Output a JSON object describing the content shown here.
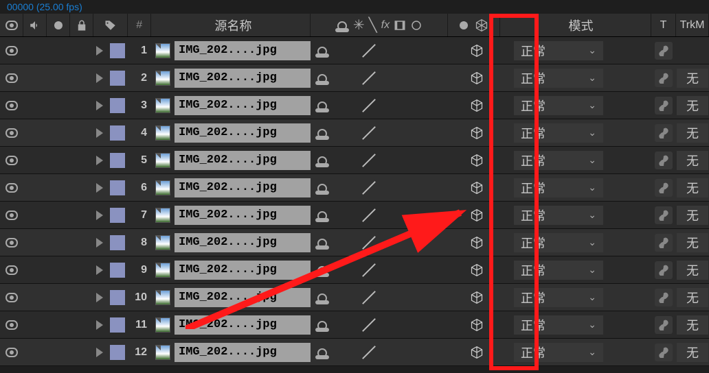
{
  "info_text": "00000 (25.00 fps)",
  "header": {
    "source_name": "源名称",
    "mode": "模式",
    "t": "T",
    "trk": "TrkM"
  },
  "layers": [
    {
      "num": 1,
      "name": "IMG_202....jpg",
      "parent": "正常",
      "link": ""
    },
    {
      "num": 2,
      "name": "IMG_202....jpg",
      "parent": "正常",
      "link": "无"
    },
    {
      "num": 3,
      "name": "IMG_202....jpg",
      "parent": "正常",
      "link": "无"
    },
    {
      "num": 4,
      "name": "IMG_202....jpg",
      "parent": "正常",
      "link": "无"
    },
    {
      "num": 5,
      "name": "IMG_202....jpg",
      "parent": "正常",
      "link": "无"
    },
    {
      "num": 6,
      "name": "IMG_202....jpg",
      "parent": "正常",
      "link": "无"
    },
    {
      "num": 7,
      "name": "IMG_202....jpg",
      "parent": "正常",
      "link": "无"
    },
    {
      "num": 8,
      "name": "IMG_202....jpg",
      "parent": "正常",
      "link": "无"
    },
    {
      "num": 9,
      "name": "IMG_202....jpg",
      "parent": "正常",
      "link": "无"
    },
    {
      "num": 10,
      "name": "IMG_202....jpg",
      "parent": "正常",
      "link": "无"
    },
    {
      "num": 11,
      "name": "IMG_202....jpg",
      "parent": "正常",
      "link": "无"
    },
    {
      "num": 12,
      "name": "IMG_202....jpg",
      "parent": "正常",
      "link": "无"
    }
  ],
  "num_hash": "#"
}
